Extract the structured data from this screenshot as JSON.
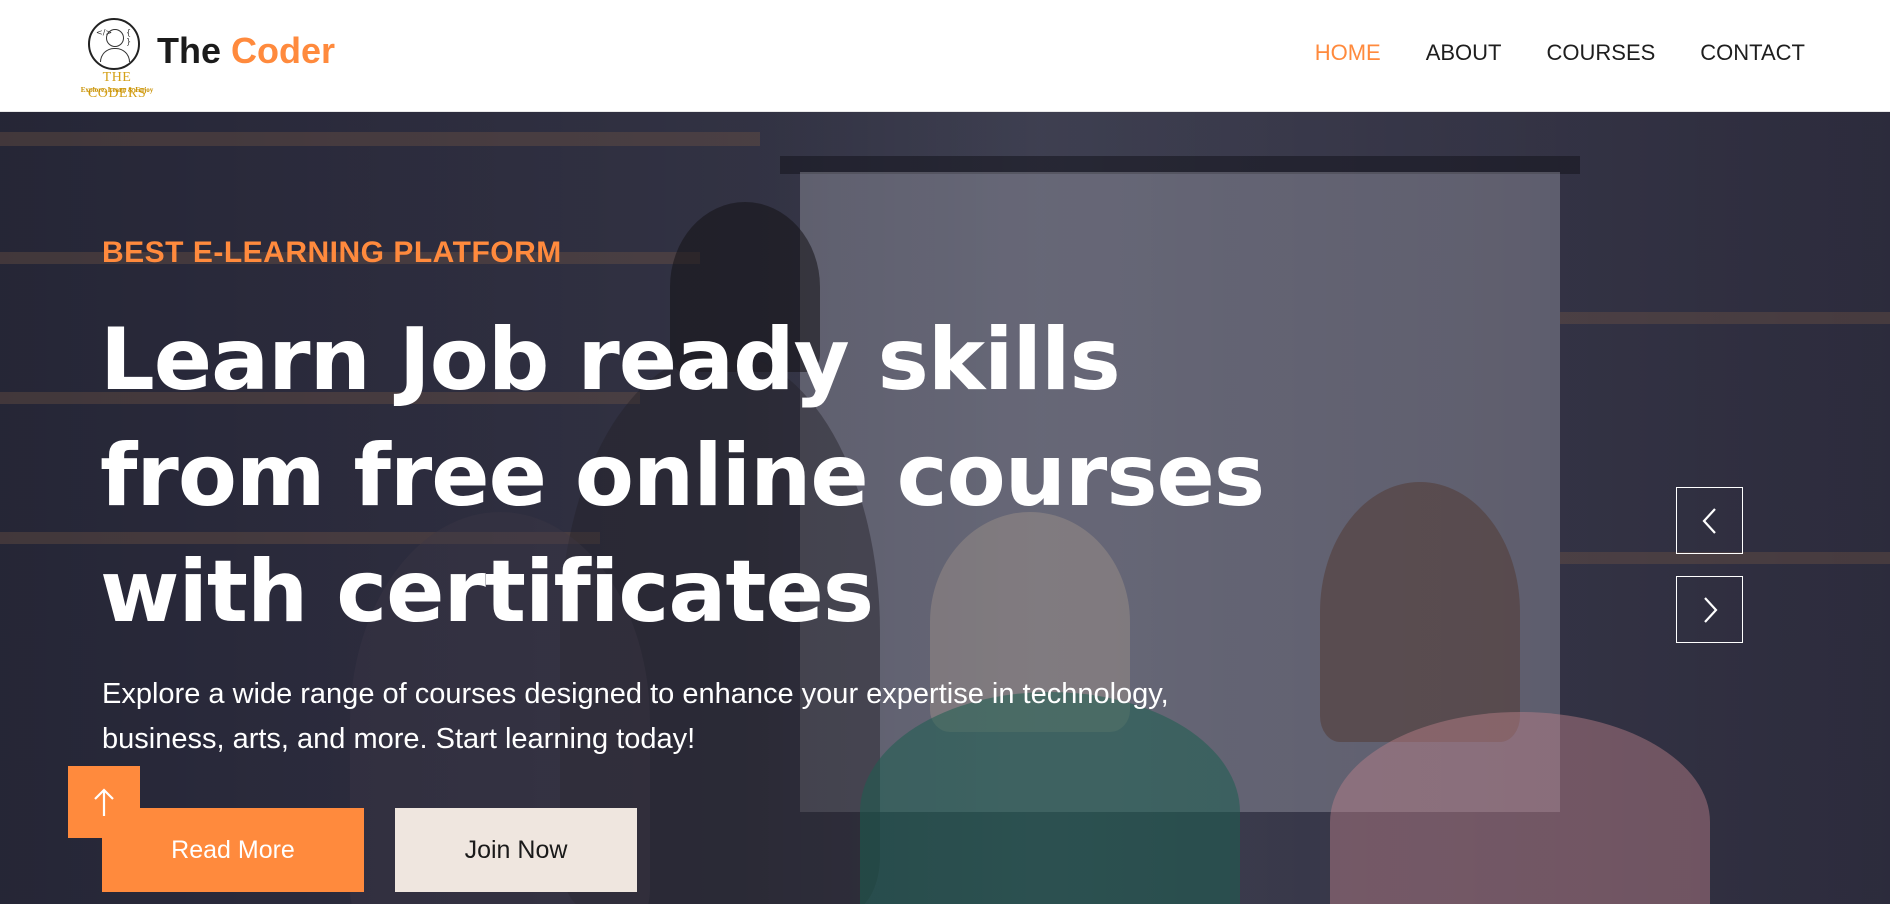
{
  "brand": {
    "name_prefix": "The",
    "name_accent": "Coder",
    "logo_title": "THE CODERS",
    "logo_tagline": "Explore, Learn & Enjoy"
  },
  "nav": {
    "items": [
      {
        "label": "HOME",
        "active": true
      },
      {
        "label": "ABOUT",
        "active": false
      },
      {
        "label": "COURSES",
        "active": false
      },
      {
        "label": "CONTACT",
        "active": false
      }
    ]
  },
  "hero": {
    "eyebrow": "BEST E-LEARNING PLATFORM",
    "headline_line1": "Learn Job ready skills",
    "headline_line2": "from free online courses",
    "headline_line3": "with certificates",
    "subtext_line1": "Explore a wide range of courses designed to enhance your expertise in technology,",
    "subtext_line2": "business, arts, and more. Start learning today!",
    "read_more_label": "Read More",
    "join_now_label": "Join Now"
  },
  "icons": {
    "prev": "chevron-left-icon",
    "next": "chevron-right-icon",
    "scroll_top": "arrow-up-icon"
  },
  "colors": {
    "accent": "#ff8a3d",
    "text_dark": "#1e1e1e",
    "hero_overlay": "#181a30",
    "join_bg": "#efe6df"
  }
}
